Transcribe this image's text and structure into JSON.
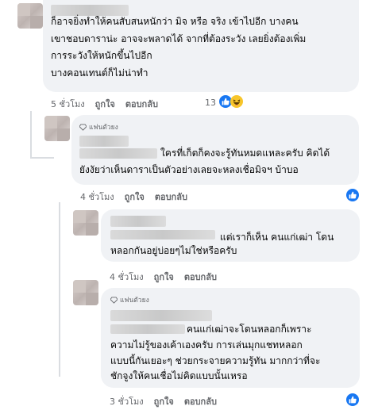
{
  "comments": [
    {
      "lines": [
        "ก็อาจยิ่งทำให้คนสับสนหนักว่า มิจ หรือ จริง เข้าไปอีก บางคน",
        "เขาชอบดาราน่ะ อาจจะพลาดได้ จากที่ต้องระวัง เลยยิ่งต้องเพิ่ม",
        "การระวังให้หนักขึ้นไปอีก",
        "บางคอนเทนต์ก็ไม่น่าทำ"
      ],
      "time": "5 ชั่วโมง",
      "like": "ถูกใจ",
      "reply": "ตอบกลับ",
      "reaction_count": "13"
    },
    {
      "badge": "แฟนตัวยง",
      "line1_tail": "ใครที่เก็ตก็คงจะรู้ทันหมดแหละครับ คิดได้",
      "line2": "ยังงัยว่าเห็นดาราเป็นตัวอย่างเลยจะหลงเชื่อมิจฯ บ้าบอ",
      "time": "4 ชั่วโมง",
      "like": "ถูกใจ",
      "reply": "ตอบกลับ"
    },
    {
      "line1_tail": "แต่เราก็เห็น คนแก่เฒ่า โดน",
      "line2": "หลอกกันอยู่บ่อยๆไม่ใช่หรือครับ",
      "time": "4 ชั่วโมง",
      "like": "ถูกใจ",
      "reply": "ตอบกลับ"
    },
    {
      "badge": "แฟนตัวยง",
      "line1_tail": "คนแก่เฒ่าจะโดนหลอกก็เพราะ",
      "lines_rest": [
        "ความไม่รู้ของเค้าเองครับ การเล่นมุกแชทหลอก",
        "แบบนี้กันเยอะๆ ช่วยกระจายความรู้ทัน มากกว่าที่จะ",
        "ชักจูงให้คนเชื่อไม่คิดแบบนั้นเหรอ"
      ],
      "time": "3 ชั่วโมง",
      "like": "ถูกใจ",
      "reply": "ตอบกลับ"
    }
  ],
  "colors": {
    "like_blue": "#1877f2",
    "bubble": "#f0f2f5",
    "meta": "#65676b"
  },
  "icons": [
    "like-icon",
    "haha-icon",
    "diamond-icon"
  ]
}
